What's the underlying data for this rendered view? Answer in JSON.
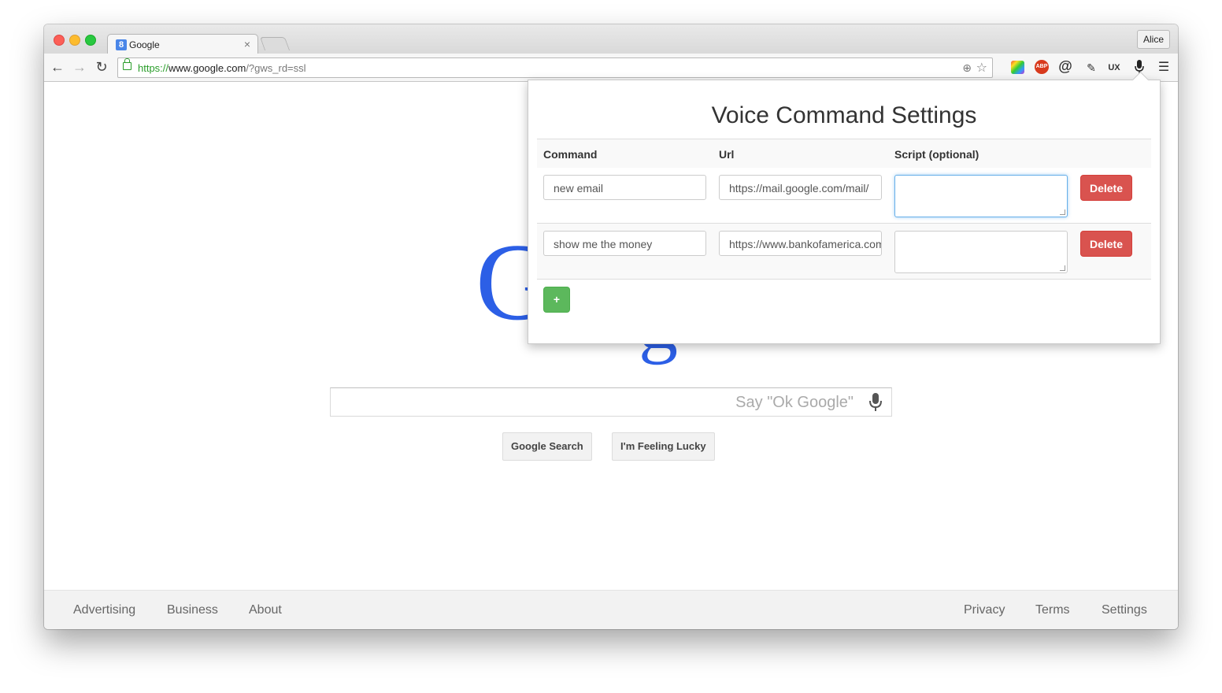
{
  "browser": {
    "tab_title": "Google",
    "tab_close": "×",
    "profile_name": "Alice",
    "url_scheme": "https://",
    "url_host": "www.google.com",
    "url_rest": "/?gws_rd=ssl",
    "extensions": [
      "colorzilla-icon",
      "adblock-plus-icon",
      "at-icon",
      "eyedropper-icon",
      "ux-check-icon",
      "microphone-icon",
      "menu-icon"
    ],
    "abp_label": "ABP",
    "ux_label": "UX"
  },
  "google": {
    "search_placeholder": "Say \"Ok Google\"",
    "search_button": "Google Search",
    "lucky_button": "I'm Feeling Lucky",
    "footer_left": [
      "Advertising",
      "Business",
      "About"
    ],
    "footer_right": [
      "Privacy",
      "Terms",
      "Settings"
    ],
    "logo_letter_1": "G",
    "logo_letter_2": "g"
  },
  "popup": {
    "title": "Voice Command Settings",
    "headers": {
      "command": "Command",
      "url": "Url",
      "script": "Script (optional)"
    },
    "rows": [
      {
        "command": "new email",
        "url": "https://mail.google.com/mail/",
        "script": ""
      },
      {
        "command": "show me the money",
        "url": "https://www.bankofamerica.com",
        "script": ""
      }
    ],
    "delete_label": "Delete",
    "add_label": "+"
  }
}
